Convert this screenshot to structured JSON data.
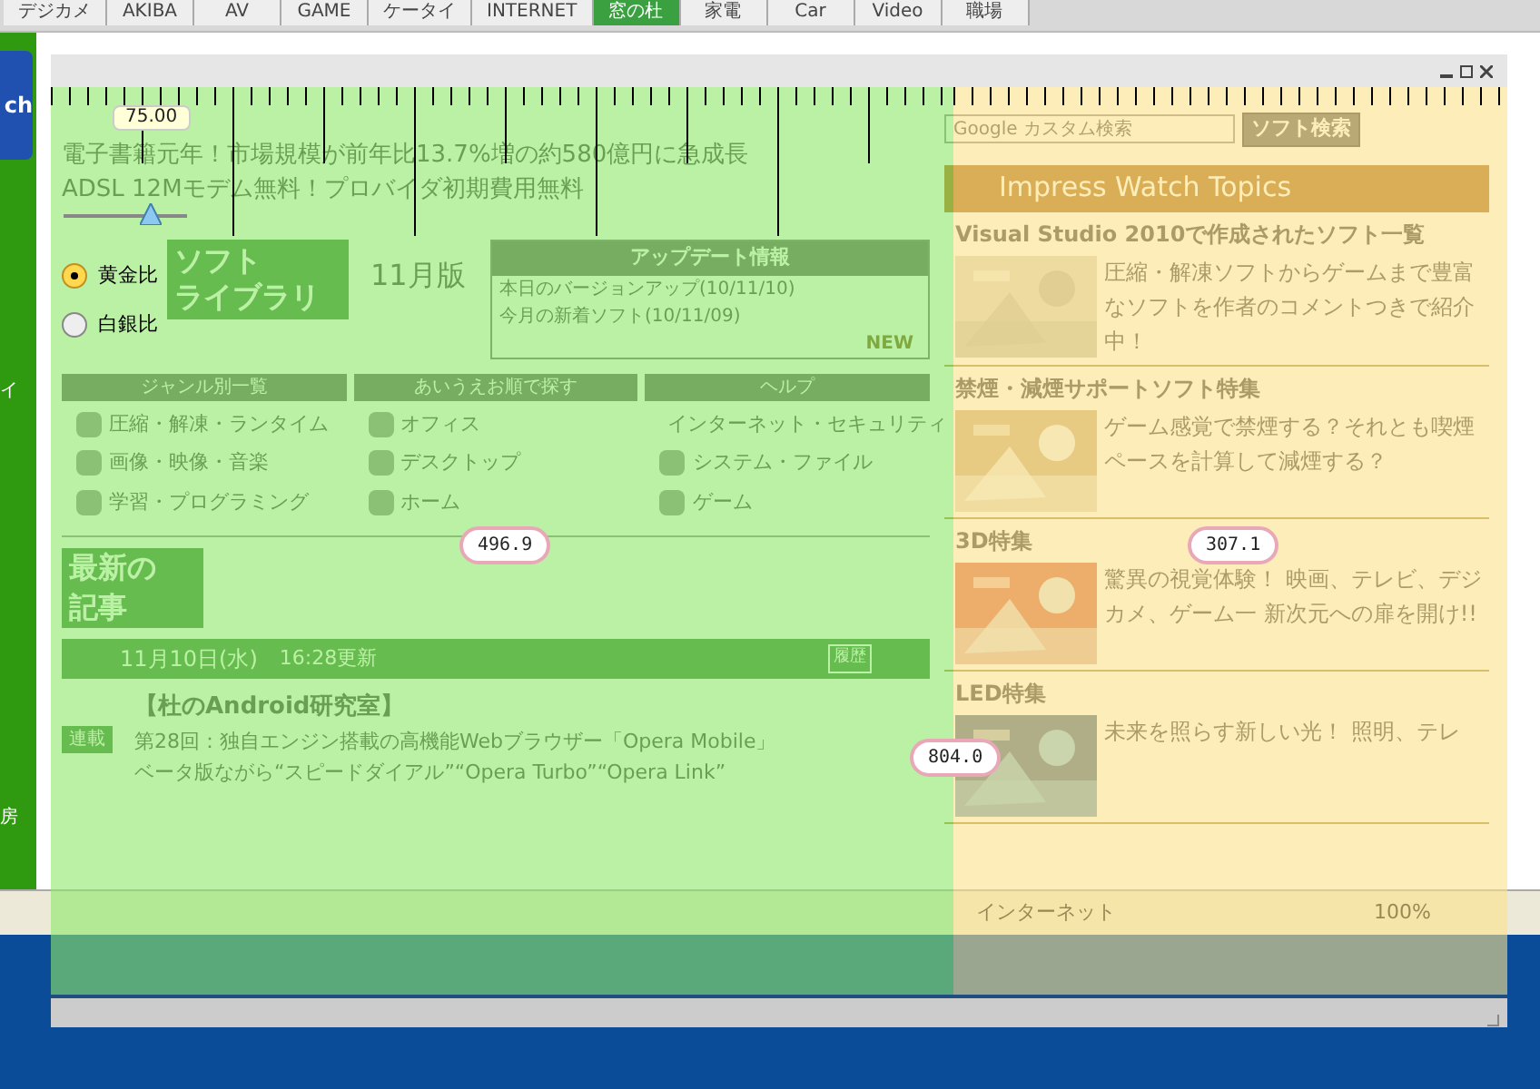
{
  "browser_tabs": [
    {
      "label": "デジカメ",
      "selected": false
    },
    {
      "label": "AKIBA",
      "selected": false
    },
    {
      "label": "AV",
      "selected": false
    },
    {
      "label": "GAME",
      "selected": false
    },
    {
      "label": "ケータイ",
      "selected": false
    },
    {
      "label": "INTERNET",
      "selected": false
    },
    {
      "label": "窓の杜",
      "selected": true
    },
    {
      "label": "家電",
      "selected": false
    },
    {
      "label": "Car",
      "selected": false
    },
    {
      "label": "Video",
      "selected": false
    },
    {
      "label": "職場",
      "selected": false
    }
  ],
  "sidebar": {
    "logo": "ch",
    "items": [
      "イ",
      "房"
    ]
  },
  "headlines": [
    "電子書籍元年！市場規模が前年比13.7%増の約580億円に急成長",
    "ADSL 12Mモデム無料！プロバイダ初期費用無料"
  ],
  "search": {
    "placeholder": "Google カスタム検索",
    "button": "ソフト検索"
  },
  "library": {
    "logo": [
      "ソフト",
      "ライブラリ"
    ],
    "edition": "11月版",
    "update_title": "アップデート情報",
    "update_items": [
      "本日のバージョンアップ(10/11/10)",
      "今月の新着ソフト(10/11/09)"
    ],
    "badge": "NEW"
  },
  "categories": [
    {
      "title": "ジャンル別一覧",
      "items": [
        "圧縮・解凍・ランタイム",
        "画像・映像・音楽",
        "学習・プログラミング"
      ]
    },
    {
      "title": "あいうえお順で探す",
      "items": [
        "オフィス",
        "デスクトップ",
        "ホーム"
      ]
    },
    {
      "title": "ヘルプ",
      "items": [
        "インターネット・セキュリティ",
        "システム・ファイル",
        "ゲーム"
      ]
    }
  ],
  "latest": {
    "logo": [
      "最新の",
      "記事"
    ],
    "date": "11月10日(水)",
    "updated": "16:28更新",
    "badge": "履歴",
    "tag": "連載",
    "title": "【杜のAndroid研究室】",
    "lines": [
      "第28回：独自エンジン搭載の高機能Webブラウザー「Opera Mobile」",
      "ベータ版ながら“スピードダイアル”“Opera Turbo”“Opera Link”"
    ]
  },
  "topics": {
    "title": "Impress Watch Topics",
    "items": [
      {
        "title": "Visual Studio 2010で作成されたソフト一覧",
        "description": "圧縮・解凍ソフトからゲームまで豊富なソフトを作者のコメントつきで紹介中！"
      },
      {
        "title": "禁煙・減煙サポートソフト特集",
        "description": "ゲーム感覚で禁煙する？それとも喫煙ペースを計算して減煙する？"
      },
      {
        "title": "3D特集",
        "description": "驚異の視覚体験！ 映画、テレビ、デジカメ、ゲーム一 新次元への扉を開け!!"
      },
      {
        "title": "LED特集",
        "description": "未来を照らす新しい光！ 照明、テレ"
      }
    ]
  },
  "status_bar": {
    "zone": "インターネット",
    "zoom": "100%"
  },
  "overlay": {
    "slider": {
      "value": "75.00",
      "level": 0.75
    },
    "ratios": [
      {
        "label": "黄金比",
        "selected": true
      },
      {
        "label": "白銀比",
        "selected": false
      }
    ],
    "measures": [
      {
        "value": "496.9"
      },
      {
        "value": "307.1"
      },
      {
        "value": "804.0"
      }
    ]
  }
}
